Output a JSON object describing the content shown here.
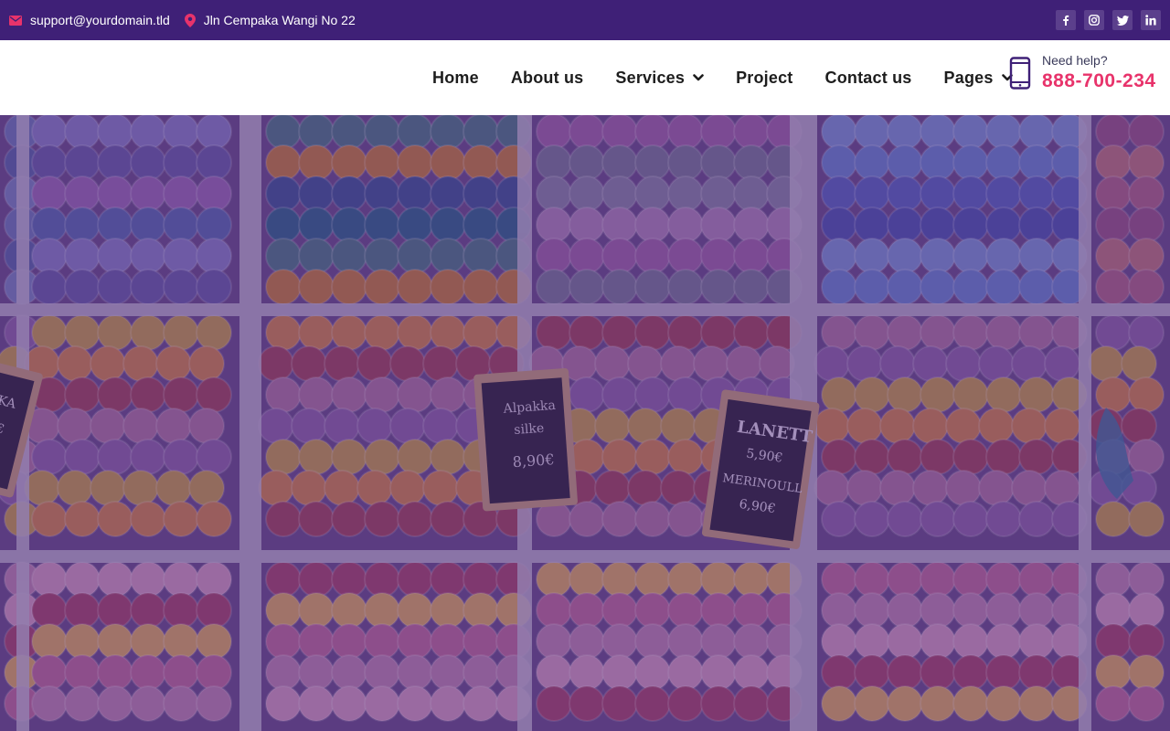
{
  "topbar": {
    "email": "support@yourdomain.tld",
    "address": "Jln Cempaka Wangi No 22",
    "social": [
      {
        "icon": "facebook-icon",
        "glyph": "f"
      },
      {
        "icon": "instagram-icon",
        "glyph": "◎"
      },
      {
        "icon": "twitter-icon",
        "glyph": "t"
      },
      {
        "icon": "linkedin-icon",
        "glyph": "in"
      }
    ]
  },
  "nav": {
    "items": [
      {
        "label": "Home",
        "dropdown": false
      },
      {
        "label": "About us",
        "dropdown": false
      },
      {
        "label": "Services",
        "dropdown": true
      },
      {
        "label": "Project",
        "dropdown": false
      },
      {
        "label": "Contact us",
        "dropdown": false
      },
      {
        "label": "Pages",
        "dropdown": true
      }
    ]
  },
  "help": {
    "label": "Need help?",
    "phone": "888-700-234"
  },
  "hero": {
    "signs": [
      {
        "lines": [
          "Alpakka",
          "silke",
          "8,90€"
        ]
      },
      {
        "lines": [
          "LANETT",
          "5,90€",
          "MERINOULL",
          "6,90€"
        ]
      },
      {
        "lines": [
          "KKA",
          "€"
        ]
      }
    ]
  },
  "colors": {
    "topbar_bg": "#3f2077",
    "accent": "#e8336b",
    "nav_text": "#1d1d1d",
    "overlay": "#481e78"
  }
}
